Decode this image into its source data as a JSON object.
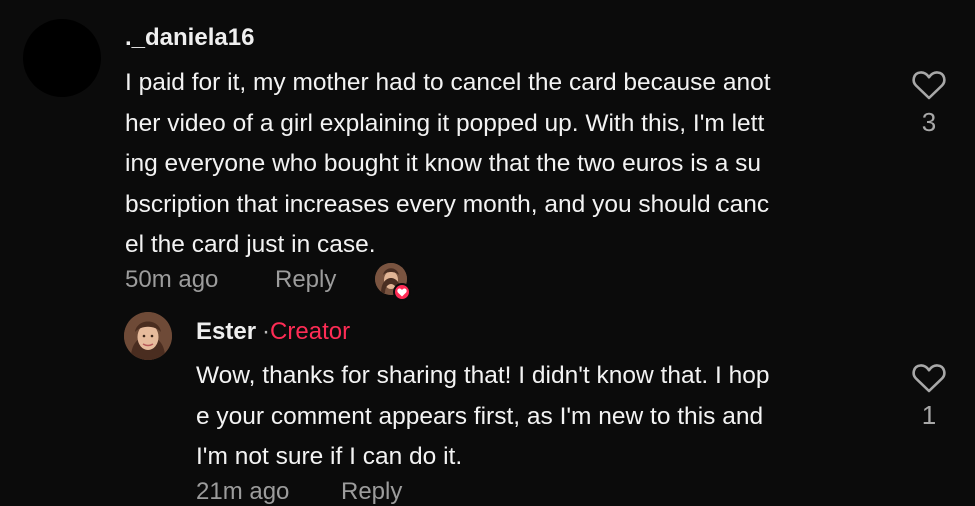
{
  "comment": {
    "username": "._daniela16",
    "lines": [
      "I paid for it, my mother had to cancel the card because anot",
      "her video of a girl explaining it popped up. With this, I'm lett",
      "ing everyone who bought it know that the two euros is a su",
      "bscription that increases every month, and you should canc",
      "el the card just in case."
    ],
    "time": "50m ago",
    "reply_label": "Reply",
    "like_count": "3"
  },
  "reply": {
    "username": "Ester",
    "separator": "·",
    "badge": "Creator",
    "lines": [
      "Wow, thanks for sharing that! I didn't know that. I hop",
      "e your comment appears first, as I'm new to this and",
      "I'm not sure if I can do it."
    ],
    "time": "21m ago",
    "reply_label": "Reply",
    "like_count": "1"
  },
  "colors": {
    "background": "#0b0b0b",
    "accent": "#fe2c55",
    "muted": "#9c9c9c"
  },
  "icons": {
    "like": "heart-outline-icon",
    "creator_liked": "heart-icon"
  }
}
